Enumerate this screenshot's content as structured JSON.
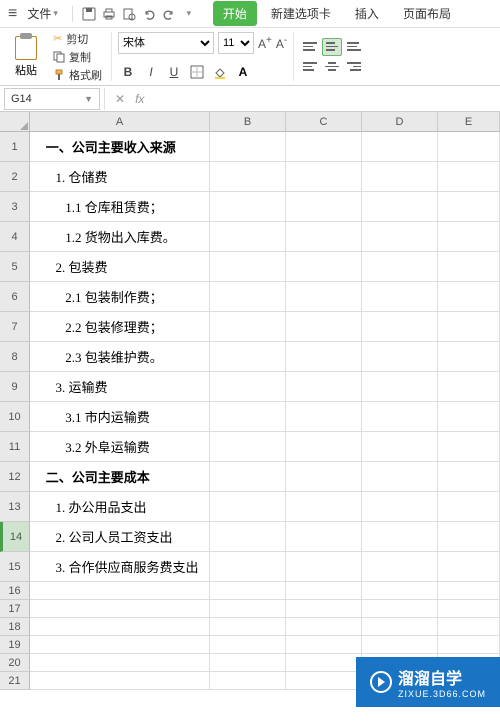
{
  "menu": {
    "file": "文件",
    "tabs": [
      "开始",
      "新建选项卡",
      "插入",
      "页面布局"
    ],
    "active_tab_index": 0
  },
  "clipboard": {
    "paste": "粘贴",
    "cut": "剪切",
    "copy": "复制",
    "format_painter": "格式刷"
  },
  "font": {
    "name": "宋体",
    "size": "11",
    "increase": "A⁺",
    "decrease": "A⁻"
  },
  "namebox": {
    "value": "G14"
  },
  "formula_bar": {
    "fx": "fx",
    "value": ""
  },
  "columns": [
    "A",
    "B",
    "C",
    "D",
    "E"
  ],
  "rows": [
    {
      "n": 1,
      "h": "tall",
      "a": "   一、公司主要收入来源",
      "bold": true
    },
    {
      "n": 2,
      "h": "tall",
      "a": "      1. 仓储费"
    },
    {
      "n": 3,
      "h": "tall",
      "a": "         1.1 仓库租赁费；"
    },
    {
      "n": 4,
      "h": "tall",
      "a": "         1.2 货物出入库费。"
    },
    {
      "n": 5,
      "h": "tall",
      "a": "      2. 包装费"
    },
    {
      "n": 6,
      "h": "tall",
      "a": "         2.1 包装制作费；"
    },
    {
      "n": 7,
      "h": "tall",
      "a": "         2.2 包装修理费；"
    },
    {
      "n": 8,
      "h": "tall",
      "a": "         2.3 包装维护费。"
    },
    {
      "n": 9,
      "h": "tall",
      "a": "      3. 运输费"
    },
    {
      "n": 10,
      "h": "tall",
      "a": "         3.1 市内运输费"
    },
    {
      "n": 11,
      "h": "tall",
      "a": "         3.2 外阜运输费"
    },
    {
      "n": 12,
      "h": "tall",
      "a": "   二、公司主要成本",
      "bold": true
    },
    {
      "n": 13,
      "h": "tall",
      "a": "      1. 办公用品支出"
    },
    {
      "n": 14,
      "h": "tall",
      "a": "      2. 公司人员工资支出",
      "selected": true
    },
    {
      "n": 15,
      "h": "tall",
      "a": "      3. 合作供应商服务费支出"
    },
    {
      "n": 16,
      "h": "short",
      "a": ""
    },
    {
      "n": 17,
      "h": "short",
      "a": ""
    },
    {
      "n": 18,
      "h": "short",
      "a": ""
    },
    {
      "n": 19,
      "h": "short",
      "a": ""
    },
    {
      "n": 20,
      "h": "short",
      "a": ""
    },
    {
      "n": 21,
      "h": "short",
      "a": ""
    }
  ],
  "watermark": {
    "brand": "溜溜自学",
    "sub": "ZIXUE.3D66.COM"
  }
}
